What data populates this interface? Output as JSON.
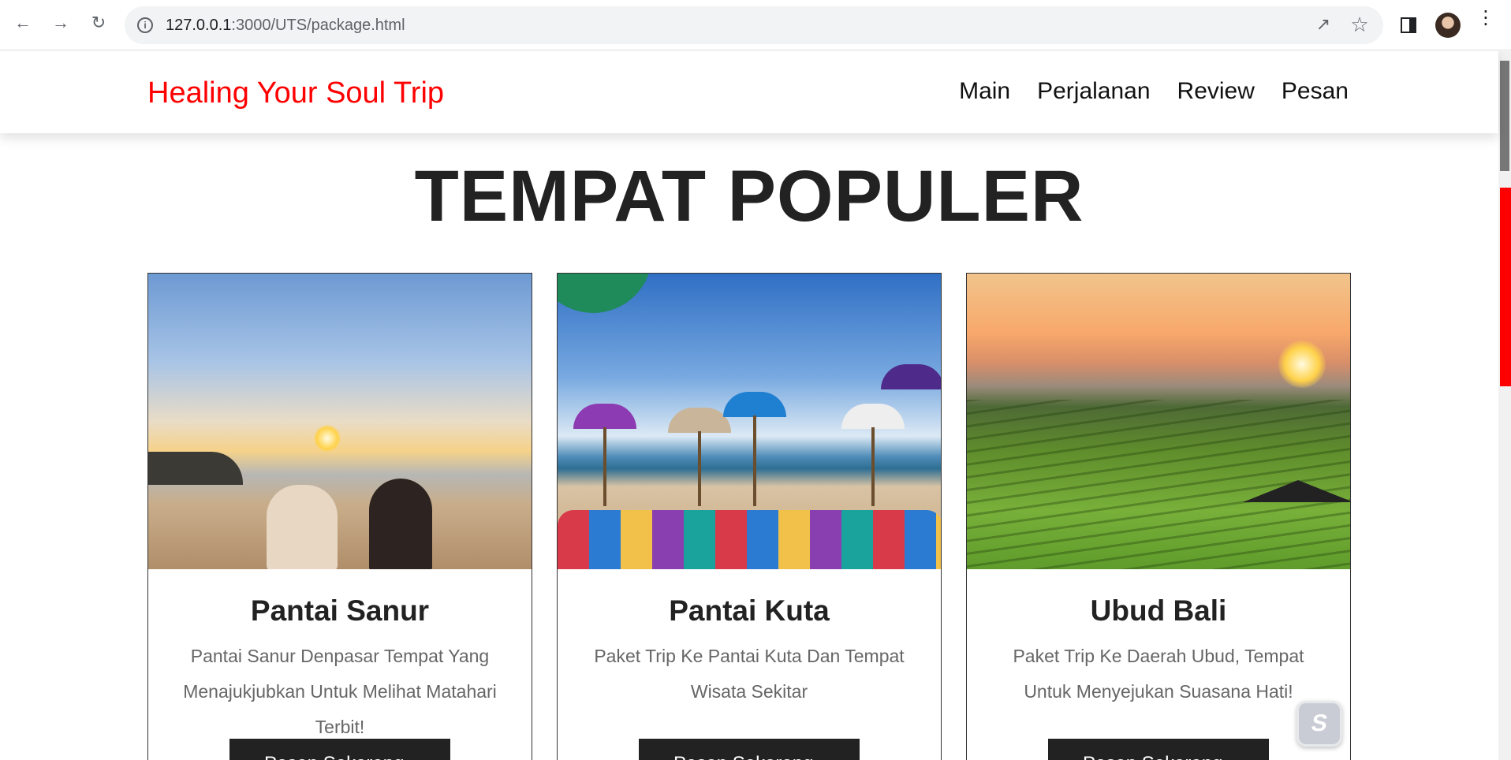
{
  "browser": {
    "url_host": "127.0.0.1",
    "url_rest": ":3000/UTS/package.html"
  },
  "site": {
    "brand": "Healing Your Soul Trip",
    "nav": [
      "Main",
      "Perjalanan",
      "Review",
      "Pesan"
    ]
  },
  "section": {
    "title": "TEMPAT POPULER"
  },
  "cards": [
    {
      "title": "Pantai Sanur",
      "description": "Pantai Sanur Denpasar Tempat Yang Menajukjubkan Untuk Melihat Matahari Terbit!",
      "button": "Pesan Sekarang"
    },
    {
      "title": "Pantai Kuta",
      "description": "Paket Trip Ke Pantai Kuta Dan Tempat Wisata Sekitar",
      "button": "Pesan Sekarang"
    },
    {
      "title": "Ubud Bali",
      "description": "Paket Trip Ke Daerah Ubud, Tempat Untuk Menyejukan Suasana Hati!",
      "button": "Pesan Sekarang"
    }
  ],
  "colors": {
    "brand": "#ff0000",
    "button_bg": "#222222"
  }
}
